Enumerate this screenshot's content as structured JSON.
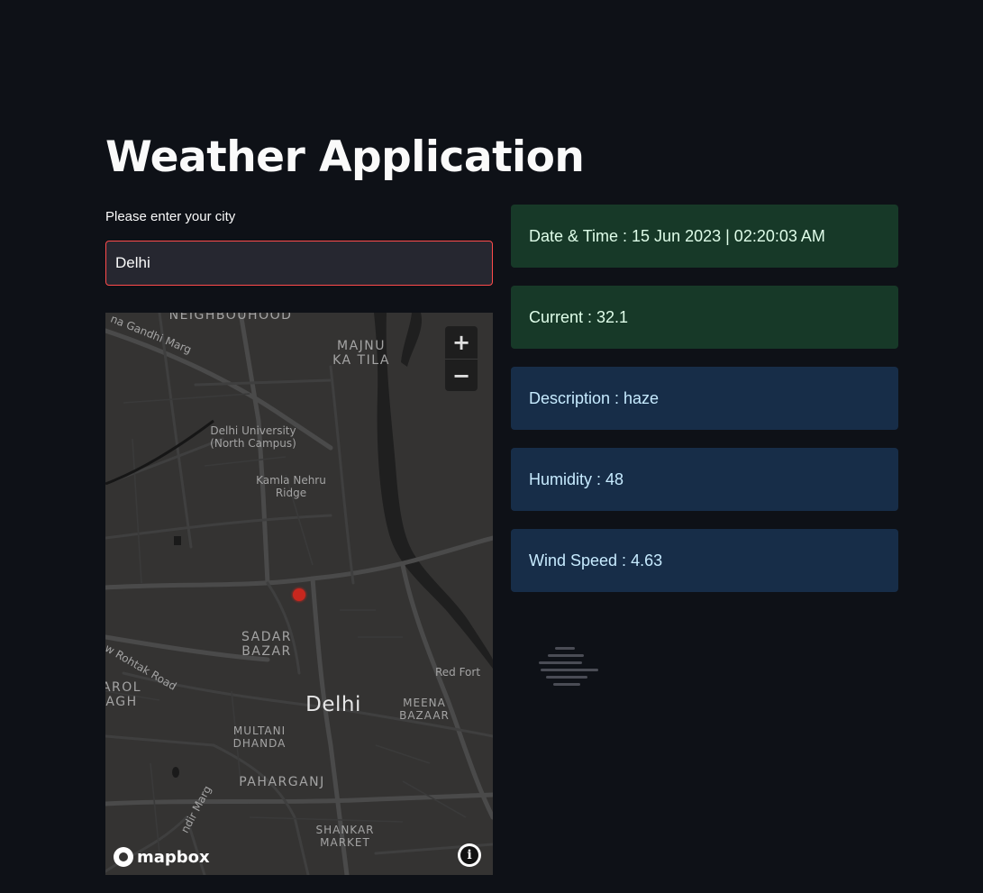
{
  "app": {
    "title": "Weather Application"
  },
  "city_input": {
    "label": "Please enter your city",
    "value": "Delhi"
  },
  "map": {
    "zoom_in": "+",
    "zoom_out": "−",
    "attribution_logo": "mapbox",
    "info_icon": "i",
    "labels": {
      "neighbourhood": "NEIGHBOUHOOD",
      "gandhi_marg": "na Gandhi Marg",
      "majnu_1": "MAJNU",
      "majnu_2": "KA TILA",
      "du_1": "Delhi University",
      "du_2": "(North Campus)",
      "kamla_1": "Kamla Nehru",
      "kamla_2": "Ridge",
      "sadar_1": "SADAR",
      "sadar_2": "BAZAR",
      "rohtak": "w Rohtak Road",
      "red_fort": "Red Fort",
      "karol_1": "AROL",
      "karol_2": "AGH",
      "city": "Delhi",
      "meena_1": "MEENA",
      "meena_2": "BAZAAR",
      "multani_1": "MULTANI",
      "multani_2": "DHANDA",
      "paharganj": "PAHARGANJ",
      "mandir": "ndir Marg",
      "shankar_1": "SHANKAR",
      "shankar_2": "MARKET"
    }
  },
  "weather_cards": [
    {
      "text": "Date & Time : 15 Jun 2023 | 02:20:03 AM",
      "kind": "success"
    },
    {
      "text": "Current : 32.1",
      "kind": "success"
    },
    {
      "text": "Description : haze",
      "kind": "info"
    },
    {
      "text": "Humidity : 48",
      "kind": "info"
    },
    {
      "text": "Wind Speed : 4.63",
      "kind": "info"
    }
  ],
  "icons": {
    "weather_icon": "haze-icon",
    "zoom_in_icon": "plus-icon",
    "zoom_out_icon": "minus-icon",
    "marker_icon": "location-dot-icon"
  },
  "colors": {
    "background": "#0e1117",
    "input_border": "#ff4b4b",
    "success_bg": "#173928",
    "info_bg": "#172d48",
    "marker": "#c8271e"
  }
}
